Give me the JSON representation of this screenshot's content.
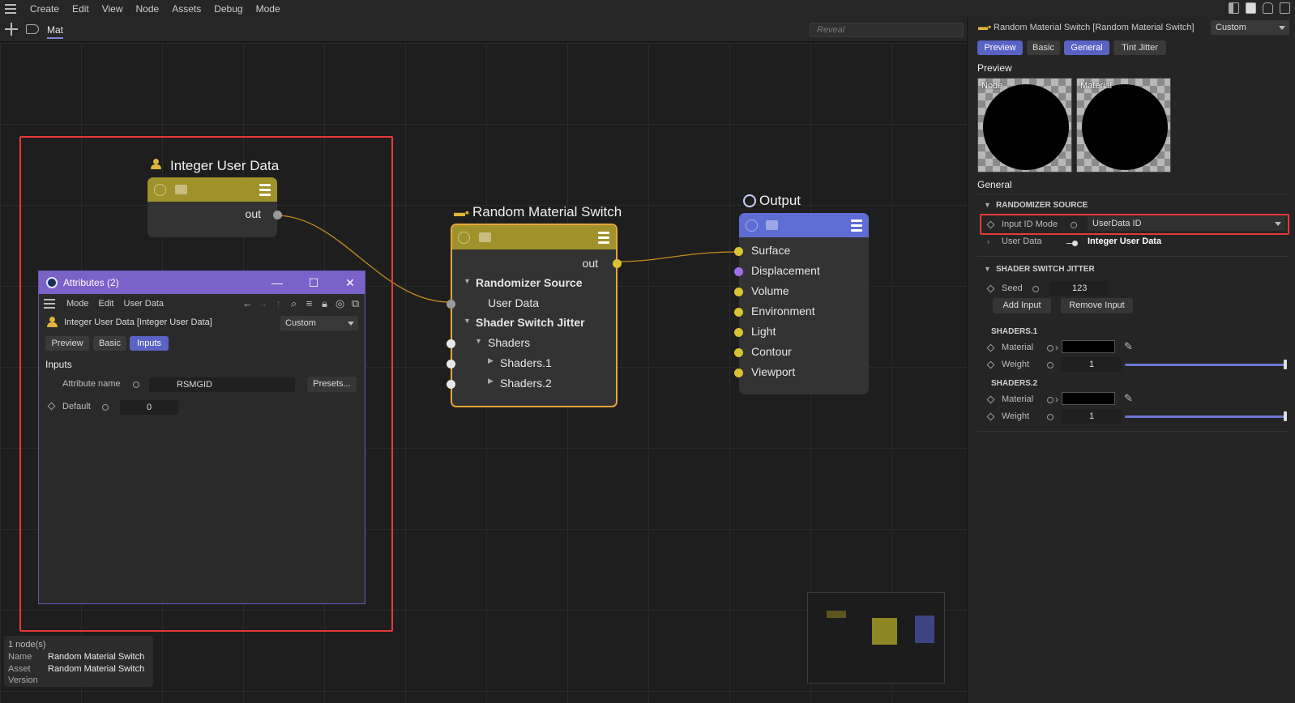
{
  "menubar": {
    "items": [
      "Create",
      "Edit",
      "View",
      "Node",
      "Assets",
      "Debug",
      "Mode"
    ]
  },
  "tabs": {
    "active": "Mat",
    "reveal_placeholder": "Reveal"
  },
  "nodes": {
    "integer_user_data": {
      "title": "Integer User Data",
      "out": "out",
      "color": "#a0922a"
    },
    "random_material_switch": {
      "title": "Random Material Switch",
      "out": "out",
      "randomizer_source": "Randomizer Source",
      "user_data": "User Data",
      "shader_switch_jitter": "Shader Switch Jitter",
      "shaders": "Shaders",
      "shaders_1": "Shaders.1",
      "shaders_2": "Shaders.2",
      "color": "#a0922a"
    },
    "output": {
      "title": "Output",
      "ports": [
        "Surface",
        "Displacement",
        "Volume",
        "Environment",
        "Light",
        "Contour",
        "Viewport"
      ],
      "color": "#5e6dd3"
    }
  },
  "attributes_window": {
    "title": "Attributes (2)",
    "menu": [
      "Mode",
      "Edit",
      "User Data"
    ],
    "object_name": "Integer User Data [Integer User Data]",
    "mode_select": "Custom",
    "tabs": [
      "Preview",
      "Basic",
      "Inputs"
    ],
    "active_tab": "Inputs",
    "section": "Inputs",
    "attribute_name_label": "Attribute name",
    "attribute_name_value": "RSMGID",
    "presets_button": "Presets...",
    "default_label": "Default",
    "default_value": "0"
  },
  "status": {
    "count": "1 node(s)",
    "name_label": "Name",
    "name_value": "Random Material Switch",
    "asset_label": "Asset",
    "asset_value": "Random Material Switch",
    "version_label": "Version"
  },
  "right_panel": {
    "title": "Random Material Switch [Random Material Switch]",
    "mode_select": "Custom",
    "tabs": [
      "Preview",
      "Basic",
      "General",
      "Tint Jitter"
    ],
    "active_tabs": [
      "Preview",
      "General"
    ],
    "preview_heading": "Preview",
    "preview_tiles": [
      "Node",
      "Material"
    ],
    "general_heading": "General",
    "randomizer_source": {
      "heading": "RANDOMIZER SOURCE",
      "input_id_mode_label": "Input ID Mode",
      "input_id_mode_value": "UserData ID",
      "user_data_label": "User Data",
      "user_data_value": "Integer User Data"
    },
    "shader_switch_jitter": {
      "heading": "SHADER SWITCH JITTER",
      "seed_label": "Seed",
      "seed_value": "123",
      "add_input": "Add Input",
      "remove_input": "Remove Input"
    },
    "shaders_1": {
      "heading": "SHADERS.1",
      "material_label": "Material",
      "weight_label": "Weight",
      "weight_value": "1"
    },
    "shaders_2": {
      "heading": "SHADERS.2",
      "material_label": "Material",
      "weight_label": "Weight",
      "weight_value": "1"
    }
  }
}
